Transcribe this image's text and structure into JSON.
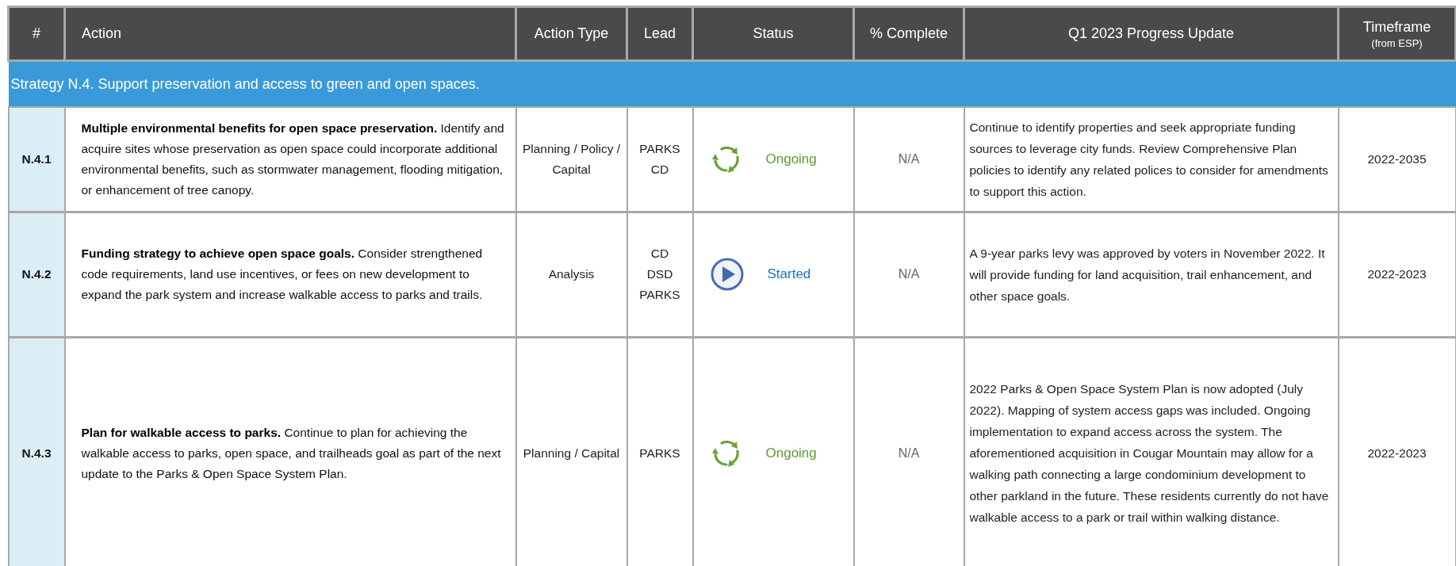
{
  "table": {
    "columns": [
      {
        "label": "#"
      },
      {
        "label": "Action"
      },
      {
        "label": "Action Type"
      },
      {
        "label": "Lead"
      },
      {
        "label": "Status"
      },
      {
        "label": "% Complete"
      },
      {
        "label": "Q1 2023 Progress Update"
      },
      {
        "label": "Timeframe",
        "sublabel": "(from ESP)"
      }
    ],
    "strategy": "Strategy N.4. Support preservation and access to green and open spaces.",
    "rows": [
      {
        "number": "N.4.1",
        "action": "**Multiple environmental benefits for open space preservation.** Identify and acquire sites whose preservation as open space could incorporate additional environmental benefits, such as stormwater management, flooding mitigation, or enhancement of tree canopy.",
        "action_type": "Planning / Policy / Capital",
        "lead": [
          "PARKS",
          "CD"
        ],
        "status": {
          "kind": "ongoing",
          "label": "Ongoing"
        },
        "percent_complete": "N/A",
        "progress_update": "Continue to identify properties and seek appropriate funding sources to leverage city funds. Review Comprehensive Plan policies to identify any related polices to consider for amendments to support this action.",
        "timeframe": "2022-2035"
      },
      {
        "number": "N.4.2",
        "action": "**Funding strategy to achieve open space goals.** Consider strengthened code requirements, land use incentives, or fees on new development to expand the park system and increase walkable access to parks and trails.",
        "action_type": "Analysis",
        "lead": [
          "CD",
          "DSD",
          "PARKS"
        ],
        "status": {
          "kind": "started",
          "label": "Started"
        },
        "percent_complete": "N/A",
        "progress_update": "A 9-year parks levy was approved by voters in November 2022.  It will provide funding for land acquisition, trail enhancement, and other space goals.",
        "timeframe": "2022-2023"
      },
      {
        "number": "N.4.3",
        "action": "**Plan for walkable access to parks.** Continue to plan for achieving the walkable access to parks, open space, and trailheads goal as part of the next update to the Parks & Open Space System Plan.",
        "action_type": "Planning / Capital",
        "lead": [
          "PARKS"
        ],
        "status": {
          "kind": "ongoing",
          "label": "Ongoing"
        },
        "percent_complete": "N/A",
        "progress_update": "2022 Parks & Open Space System Plan is now adopted (July 2022).  Mapping of system access gaps was included.  Ongoing implementation to expand access across the system.  The aforementioned acquisition in Cougar Mountain may allow for a walking path connecting a large condominium development to other parkland in the future.  These residents currently do not have walkable access to a park or trail within walking distance.",
        "timeframe": "2022-2023"
      }
    ]
  }
}
